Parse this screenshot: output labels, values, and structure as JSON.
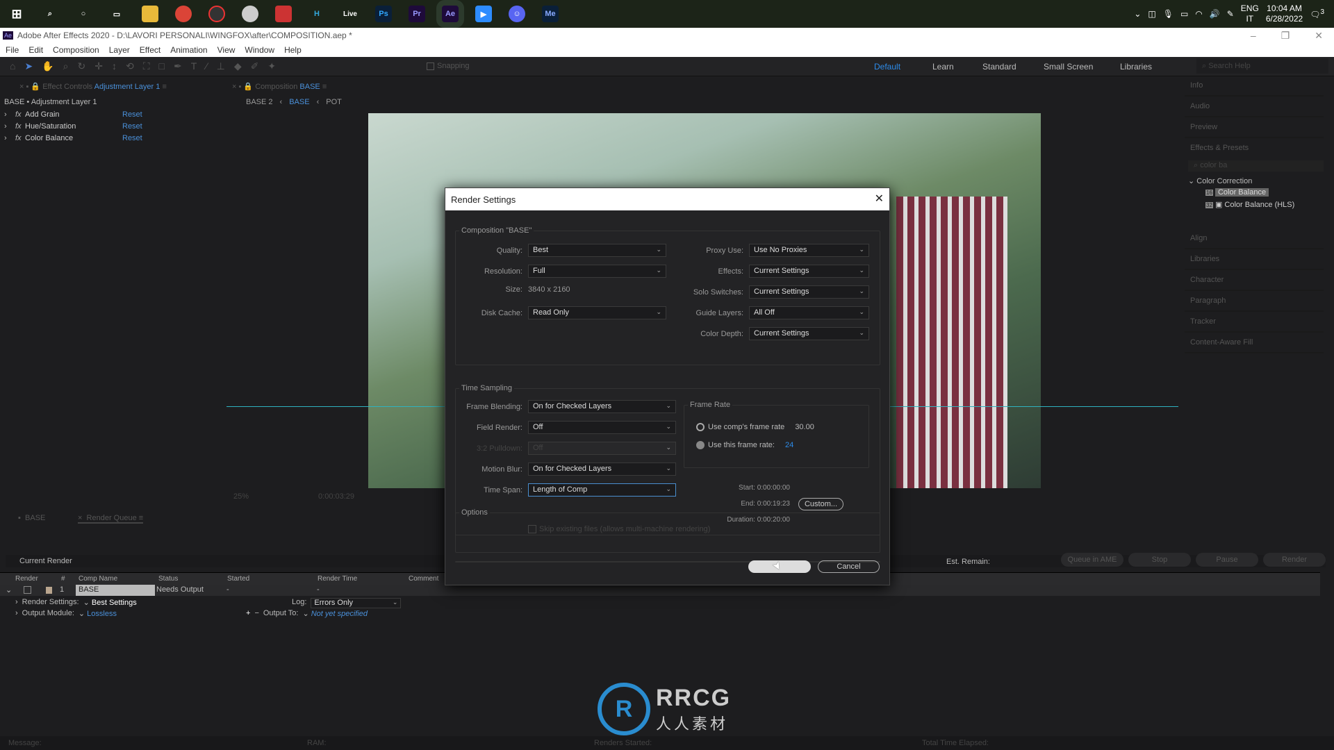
{
  "taskbar": {
    "apps": [
      "Windows",
      "Search",
      "Cortana",
      "Task View",
      "File Explorer",
      "Chrome",
      "Opera GX",
      "Cinema",
      "Ableton",
      "Houdini",
      "Live",
      "Ps",
      "Pr",
      "Ae",
      "Zoom",
      "Discord",
      "Me"
    ],
    "lang": "ENG",
    "region": "IT",
    "time": "10:04 AM",
    "date": "6/28/2022",
    "notifications": "3"
  },
  "window": {
    "app_icon": "Ae",
    "title": "Adobe After Effects 2020 - D:\\LAVORI PERSONALI\\WINGFOX\\after\\COMPOSITION.aep *"
  },
  "menu": [
    "File",
    "Edit",
    "Composition",
    "Layer",
    "Effect",
    "Animation",
    "View",
    "Window",
    "Help"
  ],
  "toolbar": {
    "snapping": "Snapping"
  },
  "workspaces": {
    "items": [
      "Default",
      "Learn",
      "Standard",
      "Small Screen",
      "Libraries"
    ],
    "active": "Default",
    "search_placeholder": "Search Help"
  },
  "effect_controls": {
    "tab_prefix": "Effect Controls",
    "tab_layer": "Adjustment Layer 1",
    "header": "BASE • Adjustment Layer 1",
    "effects": [
      {
        "name": "Add Grain",
        "reset": "Reset"
      },
      {
        "name": "Hue/Saturation",
        "reset": "Reset"
      },
      {
        "name": "Color Balance",
        "reset": "Reset"
      }
    ]
  },
  "composition": {
    "tab_prefix": "Composition",
    "tab_name": "BASE",
    "breadcrumbs": [
      "BASE 2",
      "BASE",
      "POT"
    ],
    "zoom": "25%",
    "timecode": "0:00:03:29"
  },
  "right_panels": {
    "items": [
      "Info",
      "Audio",
      "Preview",
      "Effects & Presets",
      "Align",
      "Libraries",
      "Character",
      "Paragraph",
      "Tracker",
      "Content-Aware Fill"
    ],
    "search_value": "color ba",
    "category": "Color Correction",
    "results": [
      {
        "badge": "16",
        "name": "Color Balance"
      },
      {
        "badge": "32",
        "name": "Color Balance (HLS)"
      }
    ]
  },
  "dialog": {
    "title": "Render Settings",
    "comp_group": "Composition \"BASE\"",
    "left": [
      {
        "label": "Quality:",
        "value": "Best"
      },
      {
        "label": "Resolution:",
        "value": "Full"
      },
      {
        "label": "Size:",
        "value": "3840 x 2160"
      },
      {
        "label": "Disk Cache:",
        "value": "Read Only"
      }
    ],
    "right": [
      {
        "label": "Proxy Use:",
        "value": "Use No Proxies"
      },
      {
        "label": "Effects:",
        "value": "Current Settings"
      },
      {
        "label": "Solo Switches:",
        "value": "Current Settings"
      },
      {
        "label": "Guide Layers:",
        "value": "All Off"
      },
      {
        "label": "Color Depth:",
        "value": "Current Settings"
      }
    ],
    "time_group": "Time Sampling",
    "time": [
      {
        "label": "Frame Blending:",
        "value": "On for Checked Layers"
      },
      {
        "label": "Field Render:",
        "value": "Off"
      },
      {
        "label": "3:2 Pulldown:",
        "value": "Off"
      },
      {
        "label": "Motion Blur:",
        "value": "On for Checked Layers"
      },
      {
        "label": "Time Span:",
        "value": "Length of Comp"
      }
    ],
    "frame_rate": {
      "title": "Frame Rate",
      "comp_label": "Use comp's frame rate",
      "comp_value": "30.00",
      "this_label": "Use this frame rate:",
      "this_value": "24"
    },
    "span": {
      "start": "Start: 0:00:00:00",
      "end": "End: 0:00:19:23",
      "duration": "Duration: 0:00:20:00",
      "custom": "Custom..."
    },
    "options_group": "Options",
    "skip": "Skip existing files (allows multi-machine rendering)",
    "ok": "OK",
    "cancel": "Cancel"
  },
  "render_queue": {
    "tab_base": "BASE",
    "tab": "Render Queue",
    "current_render": "Current Render",
    "est_remain": "Est. Remain:",
    "buttons": [
      "Queue in AME",
      "Stop",
      "Pause",
      "Render"
    ],
    "columns": [
      "Render",
      "#",
      "Comp Name",
      "Status",
      "Started",
      "Render Time",
      "Comment"
    ],
    "row": {
      "num": "1",
      "comp": "BASE",
      "status": "Needs Output",
      "started": "-",
      "render_time": "-"
    },
    "render_settings_label": "Render Settings:",
    "render_settings": "Best Settings",
    "log_label": "Log:",
    "log": "Errors Only",
    "output_module_label": "Output Module:",
    "output_module": "Lossless",
    "output_to_label": "Output To:",
    "output_to": "Not yet specified"
  },
  "status_bar": {
    "message": "Message:",
    "ram": "RAM:",
    "renders_started": "Renders Started:",
    "total_time": "Total Time Elapsed:"
  },
  "watermark": {
    "logo": "RRCG",
    "sub": "人人素材"
  },
  "colors": {
    "accent": "#2d8ceb",
    "link": "#4a90d9"
  }
}
